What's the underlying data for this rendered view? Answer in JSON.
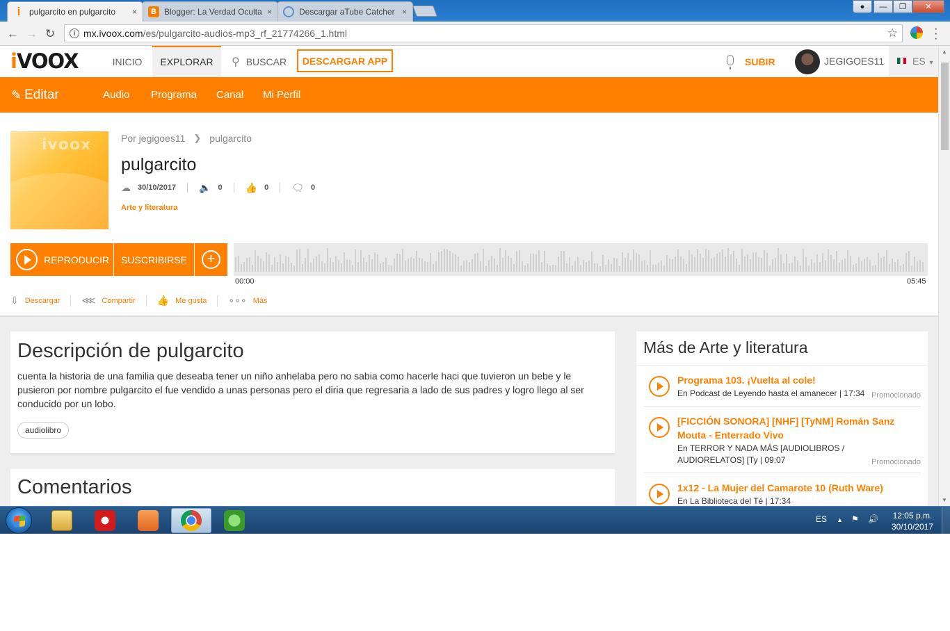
{
  "browser": {
    "tabs": [
      {
        "title": "pulgarcito en pulgarcito",
        "active": true
      },
      {
        "title": "Blogger: La Verdad Oculta",
        "active": false
      },
      {
        "title": "Descargar aTube Catcher",
        "active": false
      }
    ],
    "close_glyph": "×",
    "url_host": "mx.ivoox.com",
    "url_path": "/es/pulgarcito-audios-mp3_rf_21774266_1.html"
  },
  "site": {
    "logo_i": "i",
    "logo_rest": "VOOX",
    "nav": {
      "inicio": "INICIO",
      "explorar": "EXPLORAR",
      "buscar": "BUSCAR",
      "descargar_app": "DESCARGAR APP",
      "subir": "SUBIR",
      "user": "JEGIGOES11",
      "lang": "ES"
    },
    "editbar": {
      "edit": "Editar",
      "links": [
        "Audio",
        "Programa",
        "Canal",
        "Mi Perfil"
      ]
    }
  },
  "audio": {
    "cover_logo": "ivoox",
    "author": "Por jegigoes11",
    "program": "pulgarcito",
    "title": "pulgarcito",
    "date": "30/10/2017",
    "listens": "0",
    "likes": "0",
    "comments": "0",
    "category": "Arte y literatura",
    "play_label": "REPRODUCIR",
    "subscribe_label": "SUSCRIBIRSE",
    "plus_label": "+",
    "time_start": "00:00",
    "time_end": "05:45",
    "actions": {
      "download": "Descargar",
      "share": "Compartir",
      "like": "Me gusta",
      "more": "Más"
    }
  },
  "description": {
    "heading": "Descripción de pulgarcito",
    "text": "cuenta la historia de una familia que deseaba tener un niño anhelaba pero no sabia como hacerle haci que tuvieron un bebe y le pusieron por nombre pulgarcito el fue vendido a unas personas pero el diria que regresaria a lado de sus padres y logro llego al ser conducido por un lobo.",
    "tag": "audiolibro"
  },
  "comments": {
    "heading": "Comentarios"
  },
  "sidebar": {
    "heading": "Más de Arte y literatura",
    "items": [
      {
        "title": "Programa 103. ¡Vuelta al cole!",
        "meta": "En Podcast de Leyendo hasta el amanecer | 17:34",
        "promo": "Promocionado"
      },
      {
        "title": "[FICCIÓN SONORA] [NHF] [TyNM] Román Sanz Mouta - Enterrado Vivo",
        "meta": "En TERROR Y NADA MÁS [AUDIOLIBROS / AUDIORELATOS] [Ty | 09:07",
        "promo": "Promocionado"
      },
      {
        "title": "1x12 - La Mujer del Camarote 10 (Ruth Ware)",
        "meta": "En La Biblioteca del Té | 17:34",
        "promo": ""
      }
    ]
  },
  "taskbar": {
    "lang": "ES",
    "time": "12:05 p.m.",
    "date": "30/10/2017"
  },
  "colors": {
    "accent": "#ff8000",
    "chrome_blue": "#1e6fc0"
  },
  "icons": [
    "info-icon",
    "star-icon",
    "search-icon",
    "mic-icon",
    "pencil-icon",
    "upload-cloud-icon",
    "speaker-icon",
    "thumbs-up-icon",
    "comment-icon",
    "download-icon",
    "share-icon",
    "more-dots-icon",
    "play-icon",
    "plus-icon"
  ]
}
